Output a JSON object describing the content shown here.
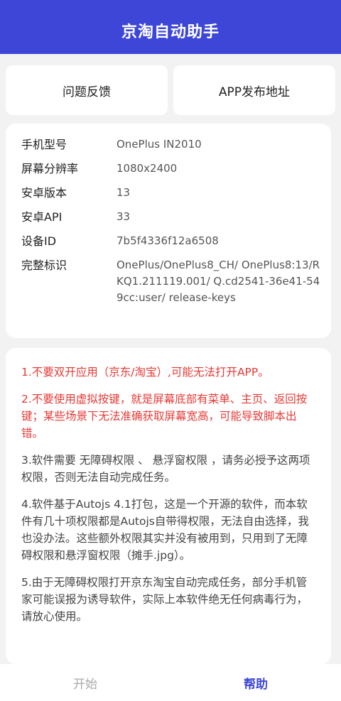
{
  "app": {
    "title": "京淘自动助手",
    "accent_color": "#3d46d6",
    "warn_color": "#e53935"
  },
  "actions": {
    "feedback_label": "问题反馈",
    "release_label": "APP发布地址"
  },
  "device_info": [
    {
      "label": "手机型号",
      "value": "OnePlus IN2010"
    },
    {
      "label": "屏幕分辨率",
      "value": "1080x2400"
    },
    {
      "label": "安卓版本",
      "value": "13"
    },
    {
      "label": "安卓API",
      "value": "33"
    },
    {
      "label": "设备ID",
      "value": "7b5f4336f12a6508"
    },
    {
      "label": "完整标识",
      "value": "OnePlus/OnePlus8_CH/ OnePlus8:13/RKQ1.211119.001/ Q.cd2541-36e41-549cc:user/ release-keys"
    }
  ],
  "help_tips": [
    {
      "text": "1.不要双开应用（京东/淘宝）,可能无法打开APP。",
      "warning": true
    },
    {
      "text": "2.不要使用虚拟按键，就是屏幕底部有菜单、主页、返回按键；某些场景下无法准确获取屏幕宽高，可能导致脚本出错。",
      "warning": true
    },
    {
      "text": "3.软件需要 无障碍权限 、 悬浮窗权限 ，请务必授予这两项权限，否则无法自动完成任务。",
      "warning": false
    },
    {
      "text": "4.软件基于Autojs 4.1打包，这是一个开源的软件，而本软件有几十项权限都是Autojs自带得权限，无法自由选择，我也没办法。这些额外权限其实并没有被用到，只用到了无障碍权限和悬浮窗权限（摊手.jpg）。",
      "warning": false
    },
    {
      "text": "5.由于无障碍权限打开京东淘宝自动完成任务，部分手机管家可能误报为诱导软件，实际上本软件绝无任何病毒行为，请放心使用。",
      "warning": false
    }
  ],
  "tabs": [
    {
      "label": "开始",
      "active": false
    },
    {
      "label": "帮助",
      "active": true
    }
  ]
}
